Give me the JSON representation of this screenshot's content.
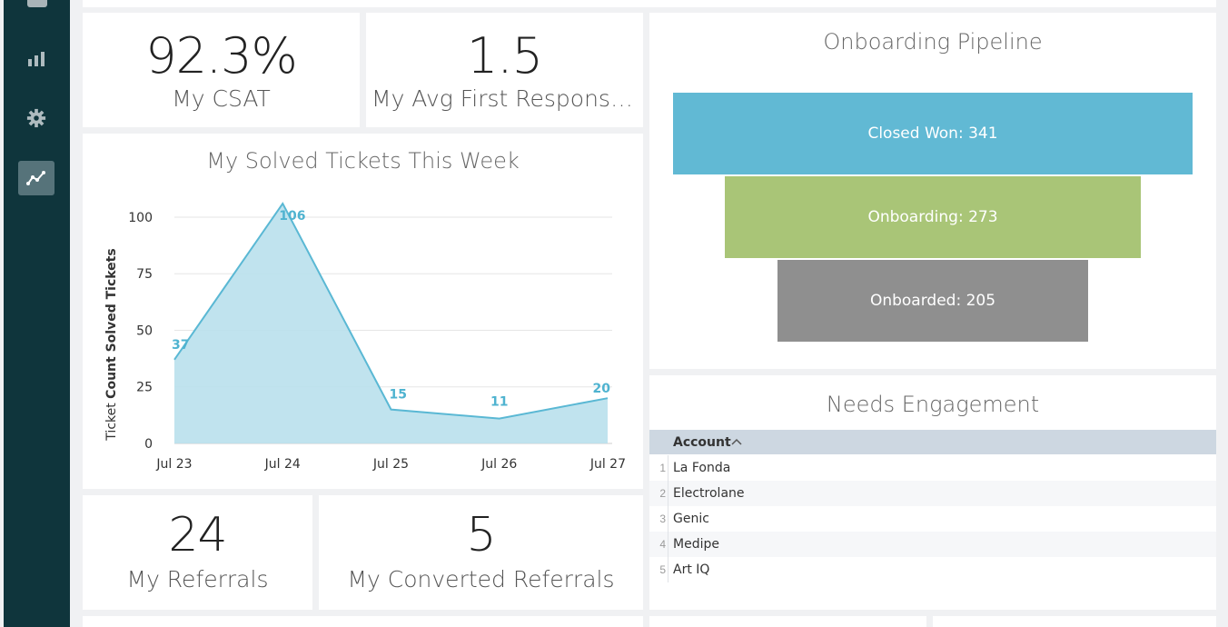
{
  "sidebar": {
    "items": [
      {
        "icon": "bar-chart-icon",
        "active": false
      },
      {
        "icon": "gear-icon",
        "active": false
      },
      {
        "icon": "line-chart-icon",
        "active": true
      }
    ]
  },
  "kpis": {
    "csat": {
      "value": "92.3%",
      "label": "My CSAT"
    },
    "first_response": {
      "value": "1.5",
      "label": "My Avg First Response ..."
    },
    "referrals": {
      "value": "24",
      "label": "My Referrals"
    },
    "converted": {
      "value": "5",
      "label": "My Converted Referrals"
    }
  },
  "solved_chart": {
    "title": "My Solved Tickets This Week",
    "ylabel_prefix": "Ticket ",
    "ylabel_bold": "Count Solved Tickets"
  },
  "chart_data": [
    {
      "type": "area",
      "title": "My Solved Tickets This Week",
      "xlabel": "",
      "ylabel": "Ticket Count Solved Tickets",
      "categories": [
        "Jul 23",
        "Jul 24",
        "Jul 25",
        "Jul 26",
        "Jul 27"
      ],
      "values": [
        37,
        106,
        15,
        11,
        20
      ],
      "yticks": [
        0,
        25,
        50,
        75,
        100
      ],
      "ylim": [
        0,
        106
      ],
      "grid": true,
      "colors": {
        "line": "#5ab8d4",
        "fill": "#b9e0ec",
        "label": "#4fb3d0"
      }
    },
    {
      "type": "funnel",
      "title": "Onboarding Pipeline",
      "stages": [
        {
          "label": "Closed Won: 341",
          "value": 341,
          "color": "#61b9d4"
        },
        {
          "label": "Onboarding: 273",
          "value": 273,
          "color": "#a9c577"
        },
        {
          "label": "Onboarded: 205",
          "value": 205,
          "color": "#8f8f8f"
        }
      ]
    }
  ],
  "needs_engagement": {
    "title": "Needs Engagement",
    "column": "Account",
    "sort_arrow": "^",
    "rows": [
      {
        "num": "1",
        "account": "La Fonda"
      },
      {
        "num": "2",
        "account": "Electrolane"
      },
      {
        "num": "3",
        "account": "Genic"
      },
      {
        "num": "4",
        "account": "Medipe"
      },
      {
        "num": "5",
        "account": "Art IQ"
      }
    ]
  }
}
